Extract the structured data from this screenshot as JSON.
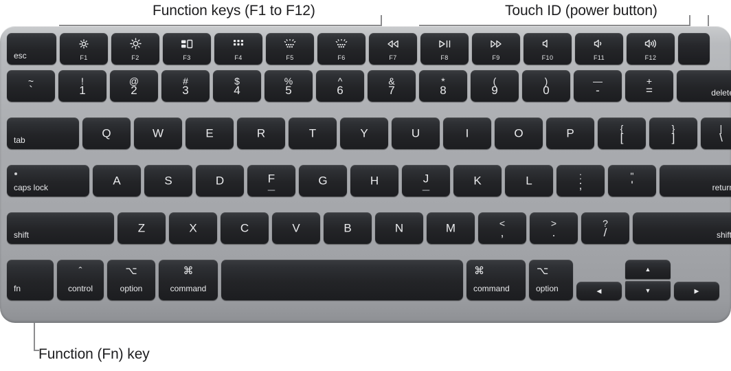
{
  "callouts": {
    "function_keys": "Function keys (F1 to F12)",
    "touch_id": "Touch ID (power button)",
    "fn_key": "Function (Fn) key"
  },
  "colors": {
    "body": "#a9abaf",
    "key": "#26272b",
    "legend": "#e9eaec",
    "leader": "#8c8c8e",
    "label_text": "#1d1d1f"
  },
  "keyboard": {
    "rows": [
      {
        "name": "function-row",
        "keys": [
          {
            "name": "esc",
            "word_bl": "esc"
          },
          {
            "name": "f1",
            "icon": "brightness-down-icon",
            "fn_label": "F1"
          },
          {
            "name": "f2",
            "icon": "brightness-up-icon",
            "fn_label": "F2"
          },
          {
            "name": "f3",
            "icon": "mission-control-icon",
            "fn_label": "F3"
          },
          {
            "name": "f4",
            "icon": "spotlight-grid-icon",
            "fn_label": "F4"
          },
          {
            "name": "f5",
            "icon": "keyboard-backlight-down-icon",
            "fn_label": "F5"
          },
          {
            "name": "f6",
            "icon": "keyboard-backlight-up-icon",
            "fn_label": "F6"
          },
          {
            "name": "f7",
            "icon": "rewind-icon",
            "fn_label": "F7"
          },
          {
            "name": "f8",
            "icon": "play-pause-icon",
            "fn_label": "F8"
          },
          {
            "name": "f9",
            "icon": "fast-forward-icon",
            "fn_label": "F9"
          },
          {
            "name": "f10",
            "icon": "mute-icon",
            "fn_label": "F10"
          },
          {
            "name": "f11",
            "icon": "volume-down-icon",
            "fn_label": "F11"
          },
          {
            "name": "f12",
            "icon": "volume-up-icon",
            "fn_label": "F12"
          },
          {
            "name": "touch-id",
            "icon": "touch-id-icon"
          }
        ]
      },
      {
        "name": "number-row",
        "keys": [
          {
            "name": "grave",
            "top": "~",
            "bottom": "`"
          },
          {
            "name": "1",
            "top": "!",
            "bottom": "1"
          },
          {
            "name": "2",
            "top": "@",
            "bottom": "2"
          },
          {
            "name": "3",
            "top": "#",
            "bottom": "3"
          },
          {
            "name": "4",
            "top": "$",
            "bottom": "4"
          },
          {
            "name": "5",
            "top": "%",
            "bottom": "5"
          },
          {
            "name": "6",
            "top": "^",
            "bottom": "6"
          },
          {
            "name": "7",
            "top": "&",
            "bottom": "7"
          },
          {
            "name": "8",
            "top": "*",
            "bottom": "8"
          },
          {
            "name": "9",
            "top": "(",
            "bottom": "9"
          },
          {
            "name": "0",
            "top": ")",
            "bottom": "0"
          },
          {
            "name": "minus",
            "top": "—",
            "bottom": "-"
          },
          {
            "name": "equal",
            "top": "+",
            "bottom": "="
          },
          {
            "name": "delete",
            "word_br": "delete"
          }
        ]
      },
      {
        "name": "qwerty-row",
        "keys": [
          {
            "name": "tab",
            "word_bl": "tab"
          },
          {
            "name": "q",
            "center": "Q"
          },
          {
            "name": "w",
            "center": "W"
          },
          {
            "name": "e",
            "center": "E"
          },
          {
            "name": "r",
            "center": "R"
          },
          {
            "name": "t",
            "center": "T"
          },
          {
            "name": "y",
            "center": "Y"
          },
          {
            "name": "u",
            "center": "U"
          },
          {
            "name": "i",
            "center": "I"
          },
          {
            "name": "o",
            "center": "O"
          },
          {
            "name": "p",
            "center": "P"
          },
          {
            "name": "bracket-left",
            "top": "{",
            "bottom": "["
          },
          {
            "name": "bracket-right",
            "top": "}",
            "bottom": "]"
          },
          {
            "name": "backslash",
            "top": "|",
            "bottom": "\\"
          }
        ]
      },
      {
        "name": "home-row",
        "keys": [
          {
            "name": "caps-lock",
            "word_bl": "caps lock",
            "caps_dot": true
          },
          {
            "name": "a",
            "center": "A"
          },
          {
            "name": "s",
            "center": "S"
          },
          {
            "name": "d",
            "center": "D"
          },
          {
            "name": "f",
            "center": "F",
            "homing": true
          },
          {
            "name": "g",
            "center": "G"
          },
          {
            "name": "h",
            "center": "H"
          },
          {
            "name": "j",
            "center": "J",
            "homing": true
          },
          {
            "name": "k",
            "center": "K"
          },
          {
            "name": "l",
            "center": "L"
          },
          {
            "name": "semicolon",
            "top": ":",
            "bottom": ";"
          },
          {
            "name": "quote",
            "top": "\"",
            "bottom": "'"
          },
          {
            "name": "return",
            "word_br": "return"
          }
        ]
      },
      {
        "name": "shift-row",
        "keys": [
          {
            "name": "shift-left",
            "word_bl": "shift"
          },
          {
            "name": "z",
            "center": "Z"
          },
          {
            "name": "x",
            "center": "X"
          },
          {
            "name": "c",
            "center": "C"
          },
          {
            "name": "v",
            "center": "V"
          },
          {
            "name": "b",
            "center": "B"
          },
          {
            "name": "n",
            "center": "N"
          },
          {
            "name": "m",
            "center": "M"
          },
          {
            "name": "comma",
            "top": "<",
            "bottom": ","
          },
          {
            "name": "period",
            "top": ">",
            "bottom": "."
          },
          {
            "name": "slash",
            "top": "?",
            "bottom": "/"
          },
          {
            "name": "shift-right",
            "word_br": "shift"
          }
        ]
      },
      {
        "name": "bottom-row",
        "keys": [
          {
            "name": "fn",
            "word_bl": "fn"
          },
          {
            "name": "control",
            "symbol": "ˆ",
            "word_center": "control"
          },
          {
            "name": "option-left",
            "symbol": "⌥",
            "word_center": "option"
          },
          {
            "name": "command-left",
            "symbol": "⌘",
            "word_center": "command"
          },
          {
            "name": "space"
          },
          {
            "name": "command-right",
            "symbol": "⌘",
            "word_bl": "command"
          },
          {
            "name": "option-right",
            "symbol": "⌥",
            "word_bl": "option"
          },
          {
            "name": "arrow-left",
            "arrow": "◀"
          },
          {
            "name": "arrow-up",
            "arrow": "▲"
          },
          {
            "name": "arrow-down",
            "arrow": "▼"
          },
          {
            "name": "arrow-right",
            "arrow": "▶"
          }
        ]
      }
    ]
  }
}
